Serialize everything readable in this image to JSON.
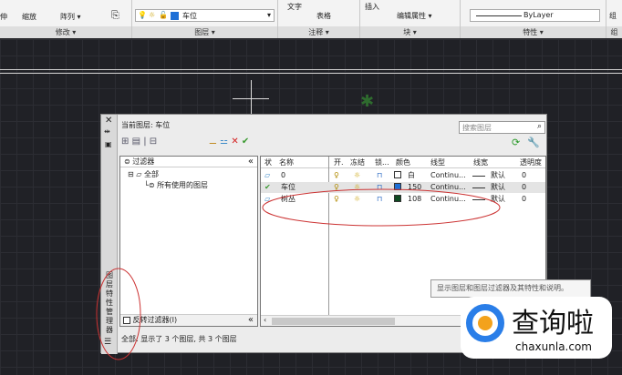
{
  "ribbon": {
    "panels": [
      "修改 ▾",
      "图层 ▾",
      "注释 ▾",
      "块 ▾",
      "特性 ▾",
      "组"
    ],
    "modify_items": [
      "伸",
      "缩放",
      "阵列 ▾"
    ],
    "current_layer": "车位",
    "text_btn": "文字",
    "table_btn": "表格",
    "insert_btn": "插入",
    "edit_attr": "编辑属性 ▾",
    "bylayer": "ByLayer",
    "group": "组"
  },
  "dialog": {
    "vertical_title": "图层特性管理器",
    "current_layer_label": "当前图层: 车位",
    "search_placeholder": "搜索图层",
    "filter_header": "过滤器",
    "filter_tree": [
      "全部",
      "所有使用的图层"
    ],
    "invert_filter": "反转过滤器(I)",
    "columns": [
      "状",
      "名称",
      "开.",
      "冻结",
      "锁...",
      "颜色",
      "线型",
      "线宽",
      "透明度"
    ],
    "layers": [
      {
        "name": "0",
        "color": "白",
        "swatch": "#ffffff",
        "linetype": "Continu...",
        "lineweight": "默认",
        "transparency": "0",
        "current": false
      },
      {
        "name": "车位",
        "color": "150",
        "swatch": "#1e6fd6",
        "linetype": "Continu...",
        "lineweight": "默认",
        "transparency": "0",
        "current": true
      },
      {
        "name": "树丛",
        "color": "108",
        "swatch": "#0f4a22",
        "linetype": "Continu...",
        "lineweight": "默认",
        "transparency": "0",
        "current": false
      }
    ],
    "status": "全部: 显示了 3 个图层, 共 3 个图层",
    "collapse": "«"
  },
  "tooltip": "显示图层和图层过滤器及其特性和说明。",
  "watermark": {
    "name": "查询啦",
    "url": "chaxunla.com"
  }
}
